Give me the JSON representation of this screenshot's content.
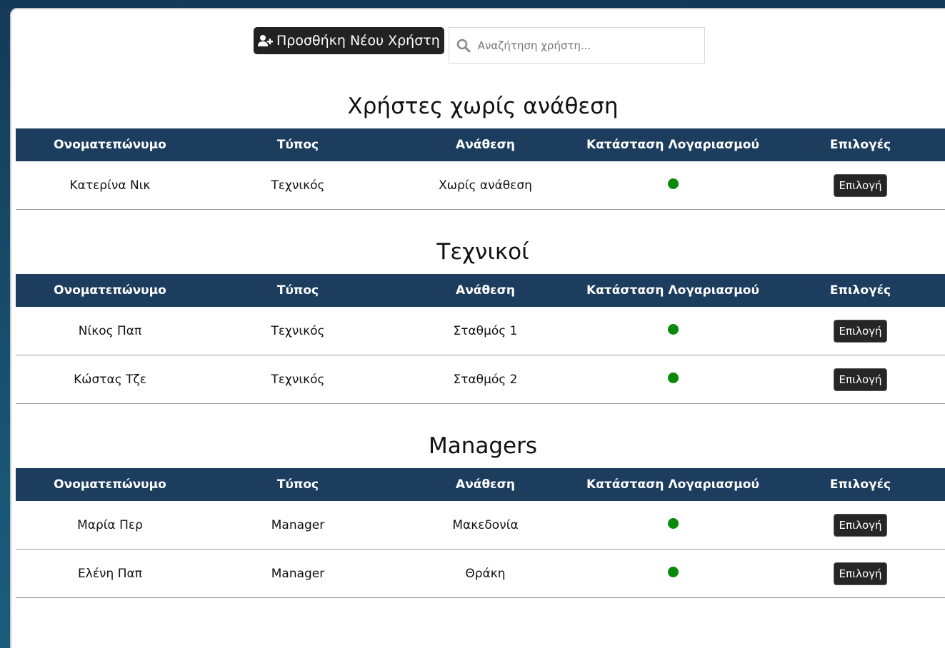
{
  "toolbar": {
    "add_user_label": "Προσθήκη Νέου Χρήστη",
    "search_placeholder": "Αναζήτηση χρήστη..."
  },
  "columns": [
    "Ονοματεπώνυμο",
    "Τύπος",
    "Ανάθεση",
    "Κατάσταση Λογαριασμού",
    "Επιλογές"
  ],
  "status_color": "#0a8a0a",
  "header_color": "#1d3d5e",
  "option_label": "Επιλογή",
  "sections": [
    {
      "title": "Χρήστες χωρίς ανάθεση",
      "rows": [
        {
          "name": "Κατερίνα Νικ",
          "type": "Τεχνικός",
          "assignment": "Χωρίς ανάθεση",
          "status": "active"
        }
      ]
    },
    {
      "title": "Τεχνικοί",
      "rows": [
        {
          "name": "Νίκος Παπ",
          "type": "Τεχνικός",
          "assignment": "Σταθμός 1",
          "status": "active"
        },
        {
          "name": "Κώστας Τζε",
          "type": "Τεχνικός",
          "assignment": "Σταθμός 2",
          "status": "active"
        }
      ]
    },
    {
      "title": "Managers",
      "rows": [
        {
          "name": "Μαρία Περ",
          "type": "Manager",
          "assignment": "Μακεδονία",
          "status": "active"
        },
        {
          "name": "Ελένη Παπ",
          "type": "Manager",
          "assignment": "Θράκη",
          "status": "active"
        }
      ]
    }
  ]
}
